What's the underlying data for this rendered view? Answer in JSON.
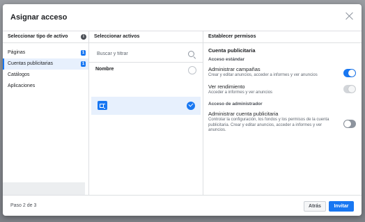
{
  "dialog": {
    "title": "Asignar acceso"
  },
  "column1": {
    "header": "Seleccionar tipo de activo",
    "info_icon": "i",
    "items": [
      {
        "label": "Páginas",
        "badge": "1"
      },
      {
        "label": "Cuentas publicitarias",
        "badge": "1"
      },
      {
        "label": "Catálogos"
      },
      {
        "label": "Aplicaciones"
      }
    ]
  },
  "column2": {
    "header": "Seleccionar activos",
    "search_placeholder": "Buscar y filtrar",
    "name_label": "Nombre"
  },
  "column3": {
    "header": "Establecer permisos",
    "section_title": "Cuenta publicitaria",
    "standard_label": "Acceso estándar",
    "admin_label": "Acceso de administrador",
    "permissions": [
      {
        "name": "Administrar campañas",
        "desc": "Crear y editar anuncios, acceder a informes y ver anuncios"
      },
      {
        "name": "Ver rendimiento",
        "desc": "Acceder a informes y ver anuncios"
      },
      {
        "name": "Administrar cuenta publicitaria",
        "desc": "Controlar la configuración, los fondos y los permisos de la cuenta publicitaria. Crear y editar anuncios, acceder a informes y ver anuncios."
      }
    ]
  },
  "footer": {
    "step": "Paso 2 de 3",
    "back": "Atrás",
    "invite": "Invitar"
  },
  "colors": {
    "accent": "#1877f2"
  }
}
